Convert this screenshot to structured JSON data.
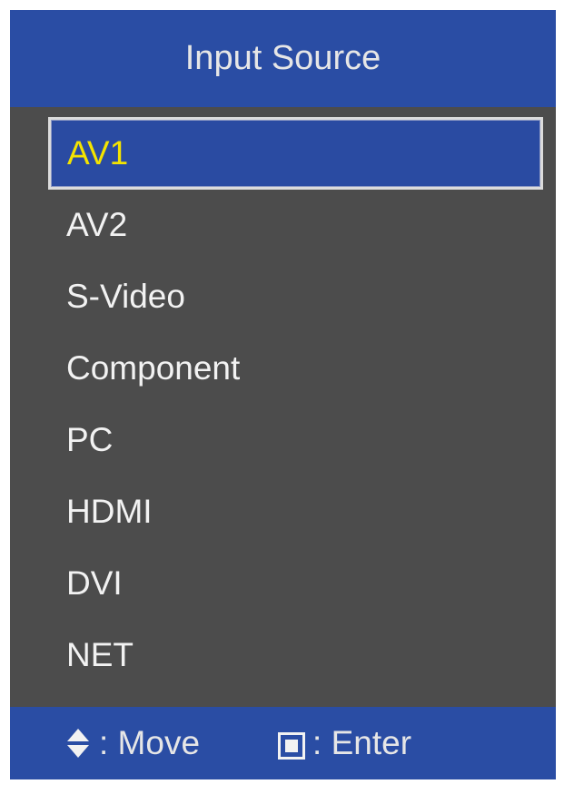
{
  "header": {
    "title": "Input Source"
  },
  "menu": {
    "selected_index": 0,
    "items": [
      {
        "label": "AV1"
      },
      {
        "label": "AV2"
      },
      {
        "label": "S-Video"
      },
      {
        "label": "Component"
      },
      {
        "label": "PC"
      },
      {
        "label": "HDMI"
      },
      {
        "label": "DVI"
      },
      {
        "label": "NET"
      }
    ]
  },
  "footer": {
    "move_hint": ": Move",
    "enter_hint": ": Enter",
    "move_icon": "up-down-arrows-icon",
    "enter_icon": "enter-square-icon"
  },
  "colors": {
    "panel_background": "#4c4c4c",
    "header_background": "#2a4da4",
    "selection_background": "#2a4ba2",
    "selected_text": "#f4e400",
    "text": "#f2f2f2"
  }
}
